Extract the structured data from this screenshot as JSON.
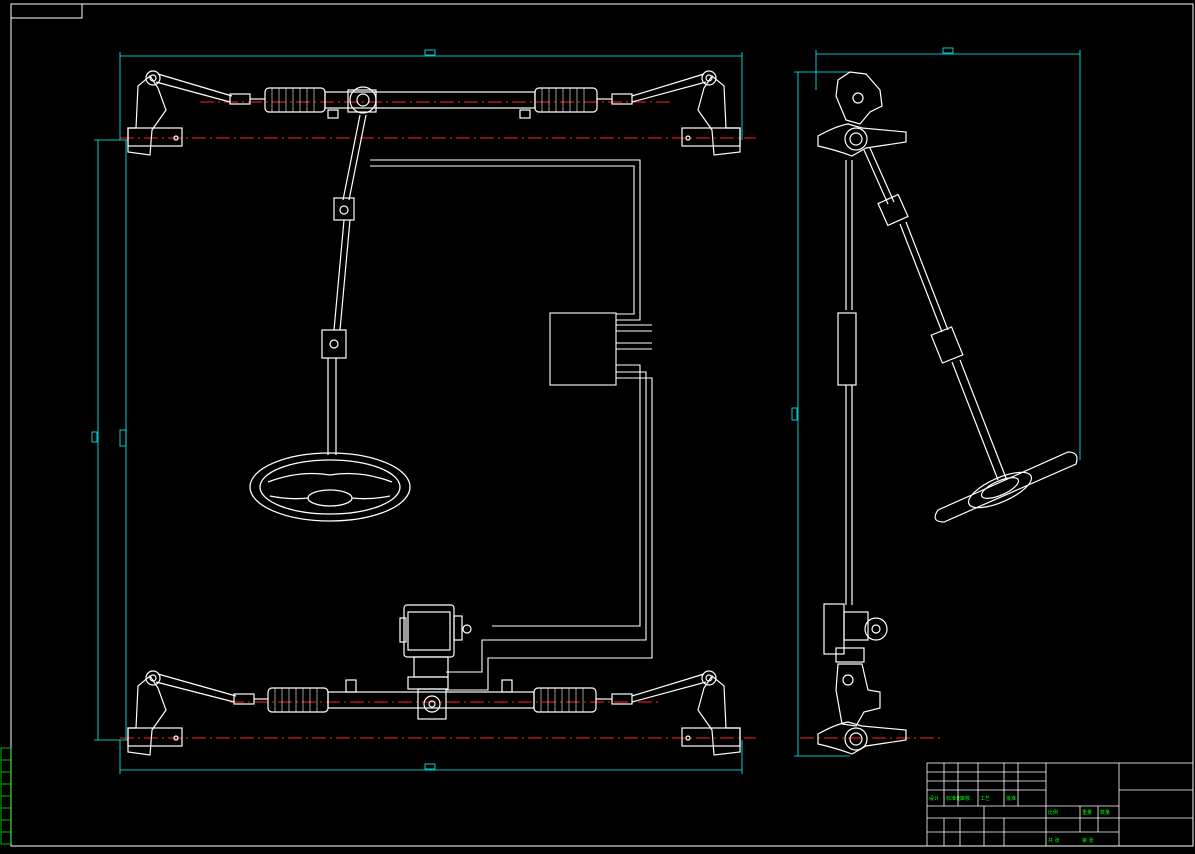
{
  "drawing": {
    "background": "#000000",
    "colors": {
      "outline": "#ffffff",
      "dimension": "#00ffff",
      "centerline": "#ff2020",
      "annotation": "#00ff00"
    }
  },
  "views": [
    {
      "name": "plan-view",
      "description_hidden": true
    },
    {
      "name": "side-view",
      "description_hidden": true
    }
  ],
  "title_block": {
    "cells_top": [
      "设计",
      "标准化",
      "审核",
      "工艺",
      "批准"
    ],
    "cells_bottom": [
      "比例",
      "重量",
      "数量",
      "共 张",
      "第 张"
    ]
  }
}
